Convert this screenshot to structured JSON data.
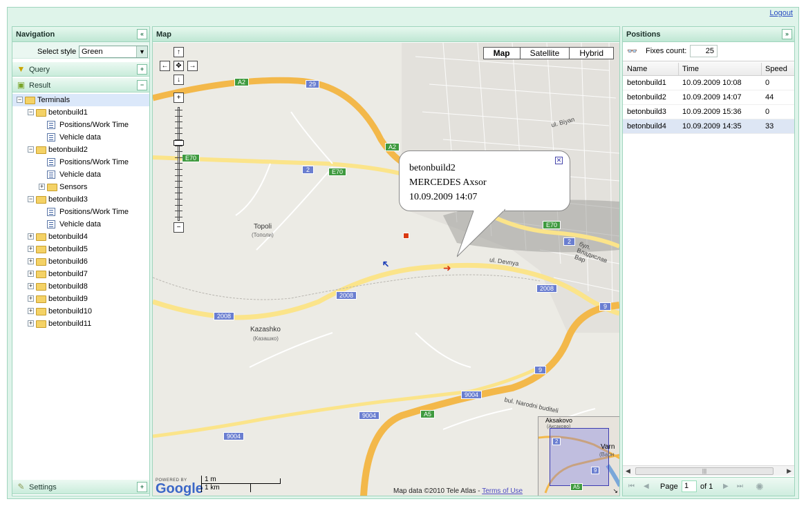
{
  "header": {
    "logout_label": "Logout"
  },
  "navigation": {
    "title": "Navigation",
    "select_style_label": "Select style",
    "select_style_value": "Green",
    "query_label": "Query",
    "result_label": "Result",
    "settings_label": "Settings",
    "tree": [
      {
        "label": "Terminals",
        "level": 0,
        "kind": "folder",
        "toggle": "−",
        "selected": true
      },
      {
        "label": "betonbuild1",
        "level": 1,
        "kind": "folder",
        "toggle": "−"
      },
      {
        "label": "Positions/Work Time",
        "level": 2,
        "kind": "doc"
      },
      {
        "label": "Vehicle data",
        "level": 2,
        "kind": "doc"
      },
      {
        "label": "betonbuild2",
        "level": 1,
        "kind": "folder",
        "toggle": "−"
      },
      {
        "label": "Positions/Work Time",
        "level": 2,
        "kind": "doc"
      },
      {
        "label": "Vehicle data",
        "level": 2,
        "kind": "doc"
      },
      {
        "label": "Sensors",
        "level": 2,
        "kind": "folder",
        "toggle": "+"
      },
      {
        "label": "betonbuild3",
        "level": 1,
        "kind": "folder",
        "toggle": "−"
      },
      {
        "label": "Positions/Work Time",
        "level": 2,
        "kind": "doc"
      },
      {
        "label": "Vehicle data",
        "level": 2,
        "kind": "doc"
      },
      {
        "label": "betonbuild4",
        "level": 1,
        "kind": "folder",
        "toggle": "+"
      },
      {
        "label": "betonbuild5",
        "level": 1,
        "kind": "folder",
        "toggle": "+"
      },
      {
        "label": "betonbuild6",
        "level": 1,
        "kind": "folder",
        "toggle": "+"
      },
      {
        "label": "betonbuild7",
        "level": 1,
        "kind": "folder",
        "toggle": "+"
      },
      {
        "label": "betonbuild8",
        "level": 1,
        "kind": "folder",
        "toggle": "+"
      },
      {
        "label": "betonbuild9",
        "level": 1,
        "kind": "folder",
        "toggle": "+"
      },
      {
        "label": "betonbuild10",
        "level": 1,
        "kind": "folder",
        "toggle": "+"
      },
      {
        "label": "betonbuild11",
        "level": 1,
        "kind": "folder",
        "toggle": "+"
      }
    ]
  },
  "map": {
    "title": "Map",
    "types": [
      "Map",
      "Satellite",
      "Hybrid"
    ],
    "active_type": "Map",
    "popup": {
      "line1": "betonbuild2",
      "line2": "MERCEDES Axsor",
      "line3": "10.09.2009 14:07"
    },
    "labels": {
      "topoli": "Topoli",
      "topoli_cyr": "(Тополи)",
      "kazashko": "Kazashko",
      "kazashko_cyr": "(Казашко)",
      "aksakovo": "Aksakovo",
      "aksakovo_cyr": "(Аксаково)",
      "varna": "Varn",
      "varna_cyr": "(Варн",
      "devnya": "ul. Devnya",
      "narodni": "bul. Narodni buditeli",
      "biyan": "ul. Biyan",
      "vladislav": "бул. Владислав Вар"
    },
    "shields": {
      "a2": "A2",
      "a5": "A5",
      "e70": "E70",
      "r29": "29",
      "r2": "2",
      "r9": "9",
      "r2008": "2008",
      "r9004": "9004"
    },
    "scale_m": "1 m",
    "scale_km": "1 km",
    "powered_by": "POWERED BY",
    "google": "Google",
    "attribution": "Map data ©2010 Tele Atlas - ",
    "terms_link": "Terms of Use"
  },
  "positions": {
    "title": "Positions",
    "fixes_label": "Fixes count:",
    "fixes_value": "25",
    "columns": [
      "Name",
      "Time",
      "Speed"
    ],
    "rows": [
      {
        "name": "betonbuild1",
        "time": "10.09.2009 10:08",
        "speed": "0"
      },
      {
        "name": "betonbuild2",
        "time": "10.09.2009 14:07",
        "speed": "44"
      },
      {
        "name": "betonbuild3",
        "time": "10.09.2009 15:36",
        "speed": "0"
      },
      {
        "name": "betonbuild4",
        "time": "10.09.2009 14:35",
        "speed": "33"
      }
    ],
    "selected_row": 3,
    "pager": {
      "page_label": "Page",
      "page_value": "1",
      "of_label": "of 1"
    }
  }
}
